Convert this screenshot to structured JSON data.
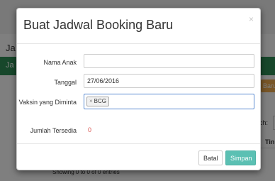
{
  "background": {
    "heading": "Ja",
    "banner": "Ja",
    "yellow_button": "Baru",
    "search_label": "rch:",
    "column_header": "Tin",
    "showing": "Showing 0 to 0 of 0 entries"
  },
  "modal": {
    "title": "Buat Jadwal Booking Baru",
    "close": "×",
    "fields": {
      "nama_anak": {
        "label": "Nama Anak",
        "value": ""
      },
      "tanggal": {
        "label": "Tanggal",
        "value": "27/06/2016"
      },
      "vaksin": {
        "label": "Vaksin yang Diminta",
        "tag": "BCG",
        "tag_remove": "×"
      },
      "jumlah": {
        "label": "Jumlah Tersedia",
        "value": "0"
      }
    },
    "buttons": {
      "cancel": "Batal",
      "save": "Simpan"
    }
  },
  "colors": {
    "save_button": "#5bc0b3",
    "count_value": "#d9534f",
    "focus_border": "#5b8bd1",
    "banner": "#2f8f57"
  }
}
